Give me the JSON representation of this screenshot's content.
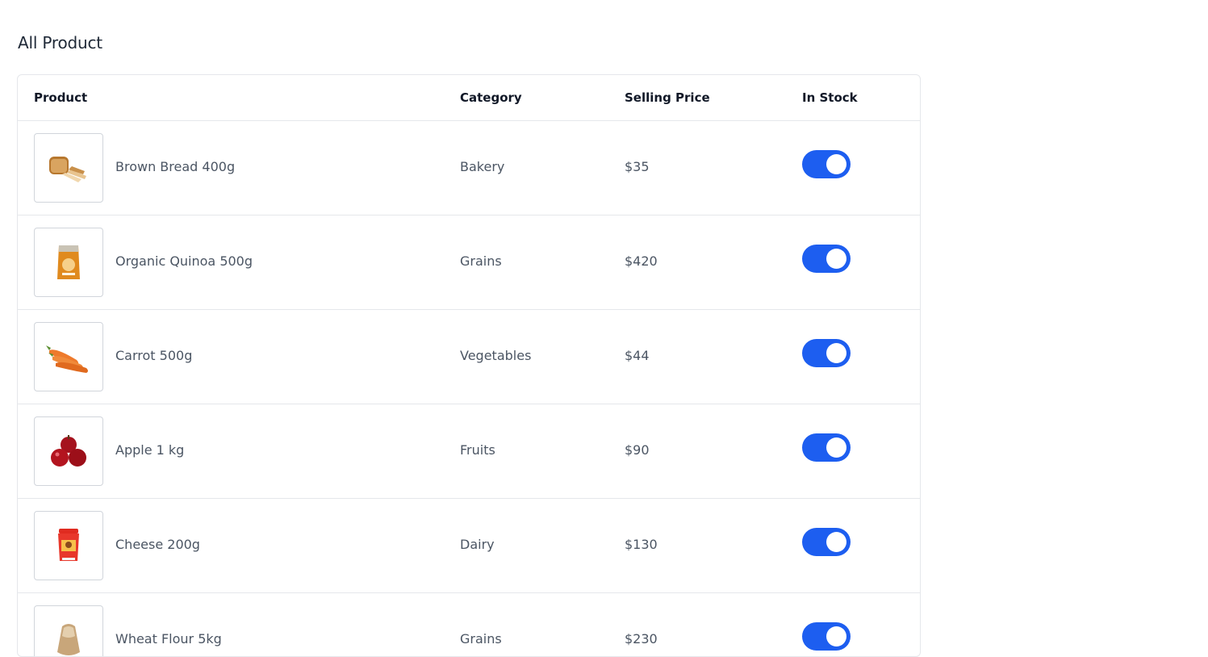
{
  "page": {
    "title": "All Product"
  },
  "table": {
    "columns": [
      "Product",
      "Category",
      "Selling Price",
      "In Stock"
    ],
    "rows": [
      {
        "name": "Brown Bread 400g",
        "category": "Bakery",
        "price": "$35",
        "in_stock": true,
        "icon": "bread-icon"
      },
      {
        "name": "Organic Quinoa 500g",
        "category": "Grains",
        "price": "$420",
        "in_stock": true,
        "icon": "quinoa-bag-icon"
      },
      {
        "name": "Carrot 500g",
        "category": "Vegetables",
        "price": "$44",
        "in_stock": true,
        "icon": "carrot-icon"
      },
      {
        "name": "Apple 1 kg",
        "category": "Fruits",
        "price": "$90",
        "in_stock": true,
        "icon": "apple-icon"
      },
      {
        "name": "Cheese 200g",
        "category": "Dairy",
        "price": "$130",
        "in_stock": true,
        "icon": "cheese-tub-icon"
      },
      {
        "name": "Wheat Flour 5kg",
        "category": "Grains",
        "price": "$230",
        "in_stock": true,
        "icon": "flour-sack-icon"
      }
    ]
  },
  "colors": {
    "accent": "#1d5ef0",
    "border": "#e5e7eb",
    "text_primary": "#111827",
    "text_secondary": "#4b5563"
  }
}
